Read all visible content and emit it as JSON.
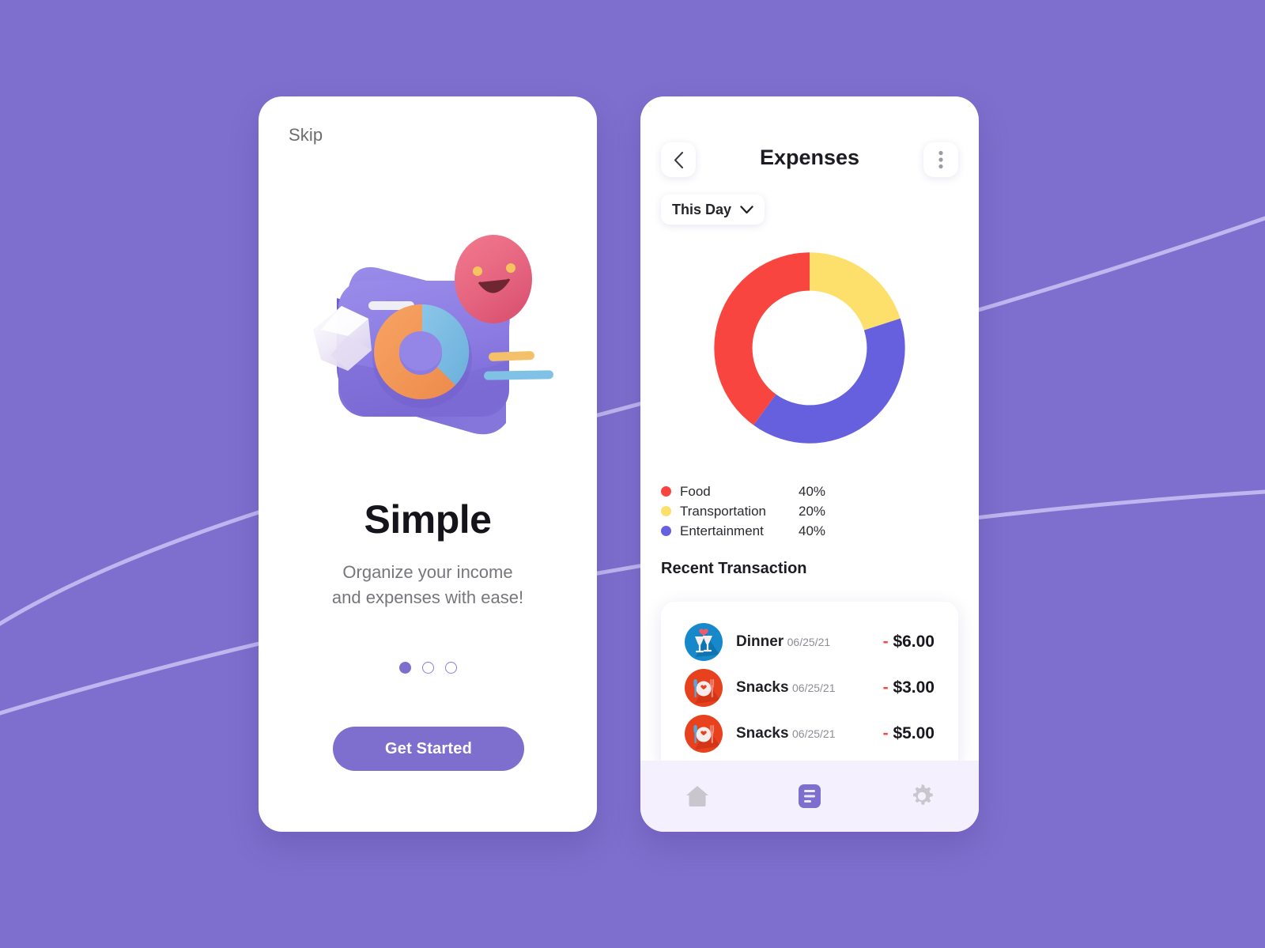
{
  "theme": {
    "background": "#7E6FCE",
    "accent": "#7E6FCE",
    "curve_line": "#C3BAF0",
    "nav_bar_bg": "#F5F0FD"
  },
  "onboarding": {
    "skip_label": "Skip",
    "headline": "Simple",
    "subline_line1": "Organize your income",
    "subline_line2": "and expenses with ease!",
    "cta_label": "Get Started",
    "pagination": {
      "total": 3,
      "active_index": 0
    },
    "illustration_name": "3d-camera-donut-chart-illustration"
  },
  "expenses": {
    "title": "Expenses",
    "back_icon": "chevron-left-icon",
    "more_icon": "three-dot-menu-icon",
    "period": {
      "label": "This Day",
      "chevron_icon": "chevron-down-icon"
    },
    "legend_header": "",
    "section_title": "Recent Transaction",
    "legend": [
      {
        "name": "Food",
        "percent": "40%",
        "color": "#F9453F",
        "value": 40
      },
      {
        "name": "Transportation",
        "percent": "20%",
        "color": "#FDE06B",
        "value": 20
      },
      {
        "name": "Entertainment",
        "percent": "40%",
        "color": "#6660DE",
        "value": 40
      }
    ],
    "transactions": [
      {
        "title": "Dinner",
        "date": "06/25/21",
        "minus": "-",
        "amount": "$6.00",
        "icon": "cheers-drinks-icon",
        "icon_bg": "#1789CA"
      },
      {
        "title": "Snacks",
        "date": "06/25/21",
        "minus": "-",
        "amount": "$3.00",
        "icon": "plate-cutlery-icon",
        "icon_bg": "#E8411E"
      },
      {
        "title": "Snacks",
        "date": "06/25/21",
        "minus": "-",
        "amount": "$5.00",
        "icon": "plate-cutlery-icon",
        "icon_bg": "#E8411E"
      }
    ],
    "nav_items": [
      {
        "name": "home",
        "icon": "home-icon",
        "active": false
      },
      {
        "name": "reports",
        "icon": "document-list-icon",
        "active": true
      },
      {
        "name": "settings",
        "icon": "gear-icon",
        "active": false
      }
    ]
  },
  "chart_data": {
    "type": "pie",
    "title": "Expenses",
    "categories": [
      "Food",
      "Transportation",
      "Entertainment"
    ],
    "values": [
      40,
      20,
      40
    ],
    "colors": [
      "#F9453F",
      "#FDE06B",
      "#6660DE"
    ],
    "unit": "%",
    "donut": true,
    "inner_radius_ratio": 0.6,
    "start_angle_deg": 0,
    "rotation": "clockwise from 12 o'clock: Transportation 20%, Entertainment 40%, Food 40%",
    "legend_position": "below",
    "grid": false
  }
}
